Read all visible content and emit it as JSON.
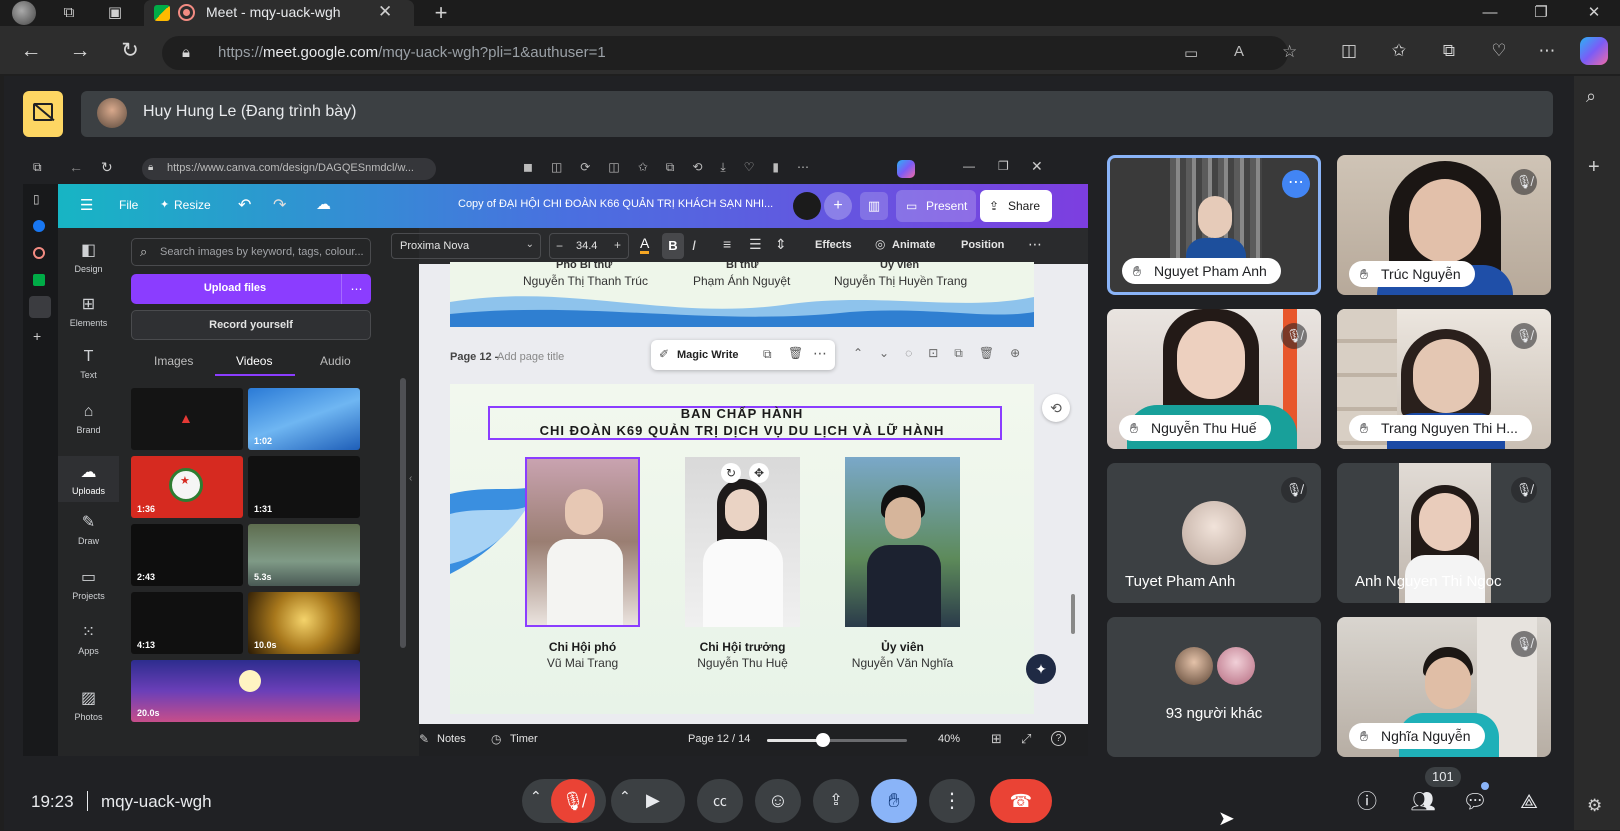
{
  "browser": {
    "tab_title": "Meet - mqy-uack-wgh",
    "url_prefix": "https://",
    "url_domain": "meet.google.com",
    "url_path": "/mqy-uack-wgh?pli=1&authuser=1"
  },
  "meet": {
    "presenter_label": "Huy Hung Le (Đang trình bày)",
    "time": "19:23",
    "meeting_code": "mqy-uack-wgh",
    "participant_count": "101",
    "participants": [
      {
        "name": "Nguyet Pham Anh",
        "hand_raised": true,
        "active": true
      },
      {
        "name": "Trúc Nguyễn",
        "hand_raised": true,
        "muted": true
      },
      {
        "name": "Nguyễn Thu Huế",
        "hand_raised": true,
        "muted": true
      },
      {
        "name": "Trang Nguyen Thi H...",
        "hand_raised": true,
        "muted": true
      },
      {
        "name": "Tuyet Pham Anh",
        "muted": true
      },
      {
        "name": "Anh Nguyen Thi Ngoc",
        "muted": true
      },
      {
        "name": "93 người khác"
      },
      {
        "name": "Nghĩa Nguyễn",
        "hand_raised": true,
        "muted": true
      }
    ]
  },
  "canva": {
    "url": "https://www.canva.com/design/DAGQESnmdcl/w...",
    "menu_file": "File",
    "menu_resize": "Resize",
    "doc_title": "Copy of ĐẠI HỘI CHI ĐOÀN K66 QUẢN TRỊ KHÁCH SẠN NHI...",
    "present_label": "Present",
    "share_label": "Share",
    "font_name": "Proxima Nova",
    "font_size": "34.4",
    "effects": "Effects",
    "animate": "Animate",
    "position": "Position",
    "rail": [
      "Design",
      "Elements",
      "Text",
      "Brand",
      "Uploads",
      "Draw",
      "Projects",
      "Apps",
      "Photos"
    ],
    "search_placeholder": "Search images by keyword, tags, colour...",
    "upload_files": "Upload files",
    "record_yourself": "Record yourself",
    "tabs": [
      "Images",
      "Videos",
      "Audio"
    ],
    "video_durations": [
      "1:02",
      "1:36",
      "1:31",
      "2:43",
      "5.3s",
      "4:13",
      "10.0s",
      "20.0s"
    ],
    "prev_page": {
      "roles": [
        "Phó Bí thư",
        "Bí thư",
        "Ủy viên"
      ],
      "names": [
        "Nguyễn Thị Thanh Trúc",
        "Phạm Ánh Nguyệt",
        "Nguyễn Thị Huyền Trang"
      ]
    },
    "page_label": "Page 12 -",
    "add_title": "Add page title",
    "magic_write": "Magic Write",
    "slide_title_1": "BAN CHẤP HÀNH",
    "slide_title_2": "CHI ĐOÀN K69 QUẢN TRỊ DỊCH VỤ DU LỊCH VÀ LỮ HÀNH",
    "members": [
      {
        "role": "Chi Hội phó",
        "name": "Vũ Mai Trang"
      },
      {
        "role": "Chi Hội trưởng",
        "name": "Nguyễn Thu Huệ"
      },
      {
        "role": "Ủy viên",
        "name": "Nguyễn Văn Nghĩa"
      }
    ],
    "notes": "Notes",
    "timer": "Timer",
    "page_indicator": "Page 12 / 14",
    "zoom": "40%",
    "zoom_fraction": 0.4
  }
}
